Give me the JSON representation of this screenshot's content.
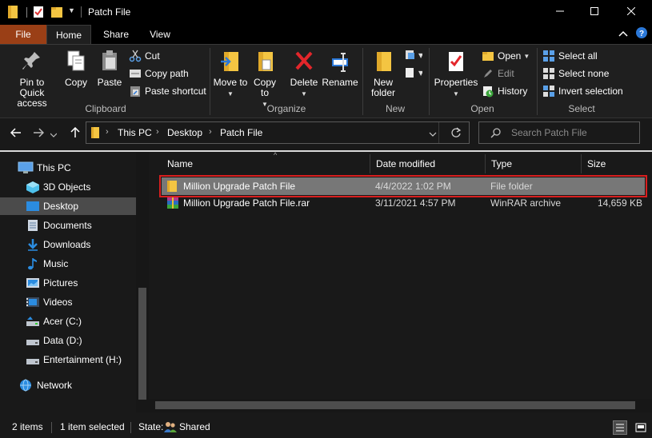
{
  "window": {
    "title": "Patch File",
    "controls": [
      "minimize-icon",
      "maximize-icon",
      "close-icon"
    ]
  },
  "tabs": {
    "file": "File",
    "home": "Home",
    "share": "Share",
    "view": "View"
  },
  "ribbon": {
    "clipboard": {
      "label": "Clipboard",
      "pin": "Pin to Quick access",
      "copy": "Copy",
      "paste": "Paste",
      "cut": "Cut",
      "copy_path": "Copy path",
      "paste_shortcut": "Paste shortcut"
    },
    "organize": {
      "label": "Organize",
      "move_to": "Move to",
      "copy_to": "Copy to",
      "delete": "Delete",
      "rename": "Rename"
    },
    "new": {
      "label": "New",
      "new_folder": "New folder"
    },
    "open": {
      "label": "Open",
      "properties": "Properties",
      "open": "Open",
      "edit": "Edit",
      "history": "History"
    },
    "select": {
      "label": "Select",
      "select_all": "Select all",
      "select_none": "Select none",
      "invert": "Invert selection"
    }
  },
  "address": {
    "crumbs": [
      "This PC",
      "Desktop",
      "Patch File"
    ],
    "search_placeholder": "Search Patch File"
  },
  "sidebar": {
    "items": [
      {
        "label": "This PC",
        "icon": "monitor-icon"
      },
      {
        "label": "3D Objects",
        "icon": "cube-icon"
      },
      {
        "label": "Desktop",
        "icon": "desktop-icon",
        "selected": true
      },
      {
        "label": "Documents",
        "icon": "document-icon"
      },
      {
        "label": "Downloads",
        "icon": "download-icon"
      },
      {
        "label": "Music",
        "icon": "music-icon"
      },
      {
        "label": "Pictures",
        "icon": "picture-icon"
      },
      {
        "label": "Videos",
        "icon": "video-icon"
      },
      {
        "label": "Acer (C:)",
        "icon": "drive-icon"
      },
      {
        "label": "Data (D:)",
        "icon": "drive-icon"
      },
      {
        "label": "Entertainment (H:)",
        "icon": "drive-icon"
      },
      {
        "label": "Network",
        "icon": "network-icon"
      }
    ]
  },
  "columns": {
    "name": "Name",
    "date": "Date modified",
    "type": "Type",
    "size": "Size"
  },
  "files": [
    {
      "name": "Million Upgrade Patch File",
      "date": "4/4/2022 1:02 PM",
      "type": "File folder",
      "size": "",
      "selected": true
    },
    {
      "name": "Million Upgrade Patch File.rar",
      "date": "3/11/2021 4:57 PM",
      "type": "WinRAR archive",
      "size": "14,659 KB",
      "selected": false
    }
  ],
  "status": {
    "count": "2 items",
    "selected": "1 item selected",
    "state_label": "State:",
    "state_value": "Shared"
  },
  "colors": {
    "file_tab": "#9a3f16",
    "selection_outline": "#d81e1e",
    "folder": "#f4c542"
  }
}
